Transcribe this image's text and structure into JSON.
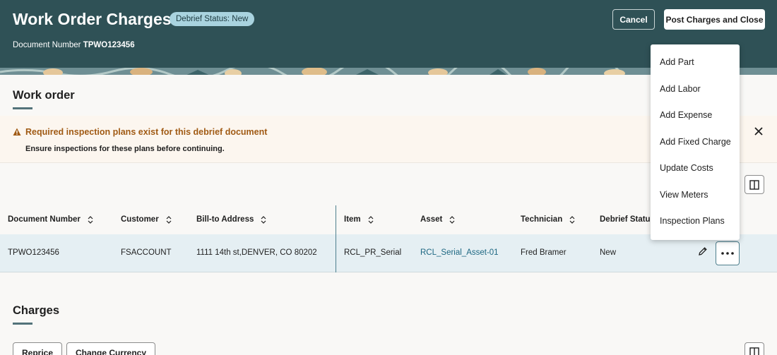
{
  "header": {
    "title": "Work Order Charges",
    "status_badge": "Debrief Status: New",
    "document_label": "Document Number",
    "document_value": "TPWO123456",
    "cancel_label": "Cancel",
    "post_label": "Post Charges and Close"
  },
  "work_order": {
    "title": "Work order"
  },
  "banner": {
    "title": "Required inspection plans exist for this debrief document",
    "description": "Ensure inspections for these plans before continuing.",
    "icon": "warning-icon",
    "close_icon": "close-icon"
  },
  "table": {
    "columns": [
      {
        "label": "Document Number",
        "sortable": true
      },
      {
        "label": "Customer",
        "sortable": true
      },
      {
        "label": "Bill-to Address",
        "sortable": true
      },
      {
        "label": "Item",
        "sortable": true
      },
      {
        "label": "Asset",
        "sortable": true
      },
      {
        "label": "Technician",
        "sortable": true
      },
      {
        "label": "Debrief Status",
        "sortable": false
      }
    ],
    "rows": [
      {
        "document_number": "TPWO123456",
        "customer": "FSACCOUNT",
        "bill_to_address": "1111 14th st,DENVER, CO 80202",
        "item": "RCL_PR_Serial",
        "asset": "RCL_Serial_Asset-01",
        "technician": "Fred Bramer",
        "debrief_status": "New"
      }
    ]
  },
  "actions_menu": {
    "items": [
      "Add Part",
      "Add Labor",
      "Add Expense",
      "Add Fixed Charge",
      "Update Costs",
      "View Meters",
      "Inspection Plans"
    ]
  },
  "charges": {
    "title": "Charges",
    "reprice_label": "Reprice",
    "change_currency_label": "Change Currency"
  },
  "colors": {
    "header_bg": "#2f5156",
    "badge_bg": "#a9d3df",
    "warning_text": "#a05a14",
    "link": "#1d6782",
    "row_highlight": "#e5eff3"
  }
}
